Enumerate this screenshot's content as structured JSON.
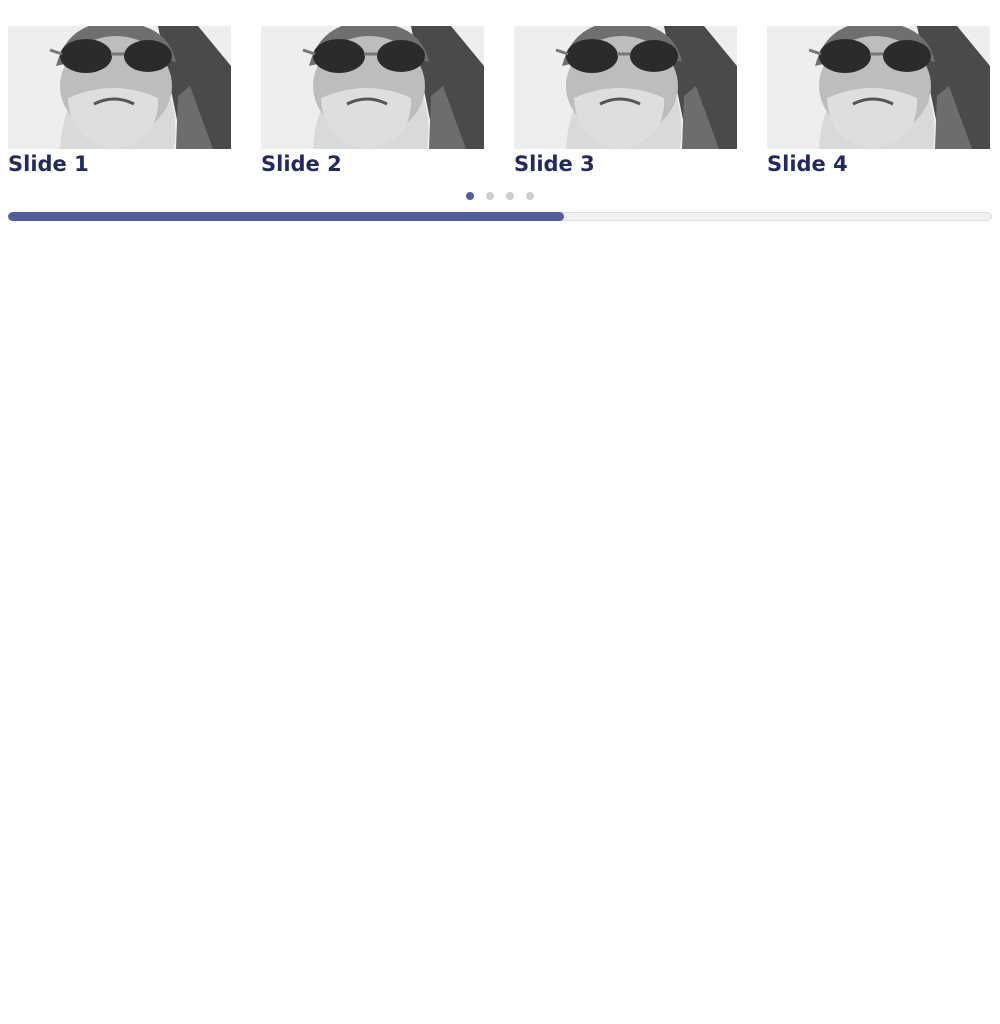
{
  "carousel": {
    "slides": [
      {
        "title": "Slide 1",
        "image_icon": "bearded-man-sunglasses-photo"
      },
      {
        "title": "Slide 2",
        "image_icon": "bearded-man-sunglasses-photo"
      },
      {
        "title": "Slide 3",
        "image_icon": "bearded-man-sunglasses-photo"
      },
      {
        "title": "Slide 4",
        "image_icon": "bearded-man-sunglasses-photo"
      }
    ],
    "pagination": {
      "count": 4,
      "active_index": 0
    },
    "progress": {
      "fraction": 0.565
    },
    "colors": {
      "accent": "#565d9c",
      "title": "#232a5c",
      "dot_inactive": "#cccccc",
      "track": "#f1f1f1"
    }
  }
}
